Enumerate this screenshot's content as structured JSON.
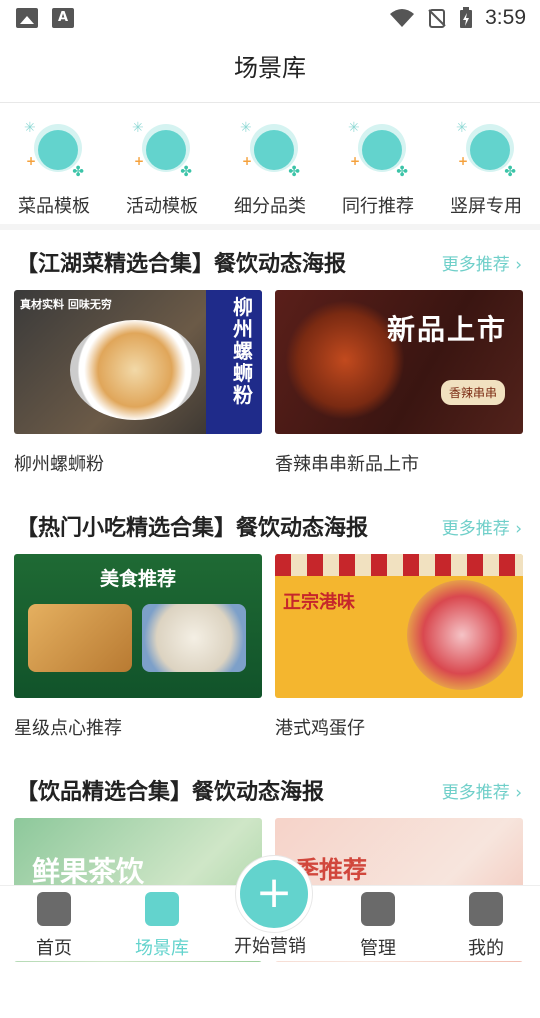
{
  "status": {
    "time": "3:59"
  },
  "header": {
    "title": "场景库"
  },
  "categories": [
    {
      "label": "菜品模板",
      "icon": "dish-cover-icon"
    },
    {
      "label": "活动模板",
      "icon": "balloons-icon"
    },
    {
      "label": "细分品类",
      "icon": "grid-icon"
    },
    {
      "label": "同行推荐",
      "icon": "flame-icon"
    },
    {
      "label": "竖屏专用",
      "icon": "video-icon"
    }
  ],
  "sections": [
    {
      "title": "【江湖菜精选合集】餐饮动态海报",
      "more": "更多推荐",
      "cards": [
        {
          "caption": "柳州螺蛳粉",
          "overlay_small": "真材实料 回味无穷",
          "overlay_big": "柳州螺蛳粉"
        },
        {
          "caption": "香辣串串新品上市",
          "overlay_big": "新品上市",
          "overlay_small": "香辣串串"
        }
      ]
    },
    {
      "title": "【热门小吃精选合集】餐饮动态海报",
      "more": "更多推荐",
      "cards": [
        {
          "caption": "星级点心推荐",
          "overlay_big": "美食推荐"
        },
        {
          "caption": "港式鸡蛋仔",
          "overlay_big": "正宗港味"
        }
      ]
    },
    {
      "title": "【饮品精选合集】餐饮动态海报",
      "more": "更多推荐",
      "cards": [
        {
          "caption": "",
          "overlay_big": "鲜果茶饮"
        },
        {
          "caption": "",
          "overlay_big": "季推荐"
        }
      ]
    }
  ],
  "tabbar": [
    {
      "label": "首页"
    },
    {
      "label": "场景库"
    },
    {
      "label": "开始营销"
    },
    {
      "label": "管理"
    },
    {
      "label": "我的"
    }
  ],
  "colors": {
    "accent": "#63d3cd"
  }
}
